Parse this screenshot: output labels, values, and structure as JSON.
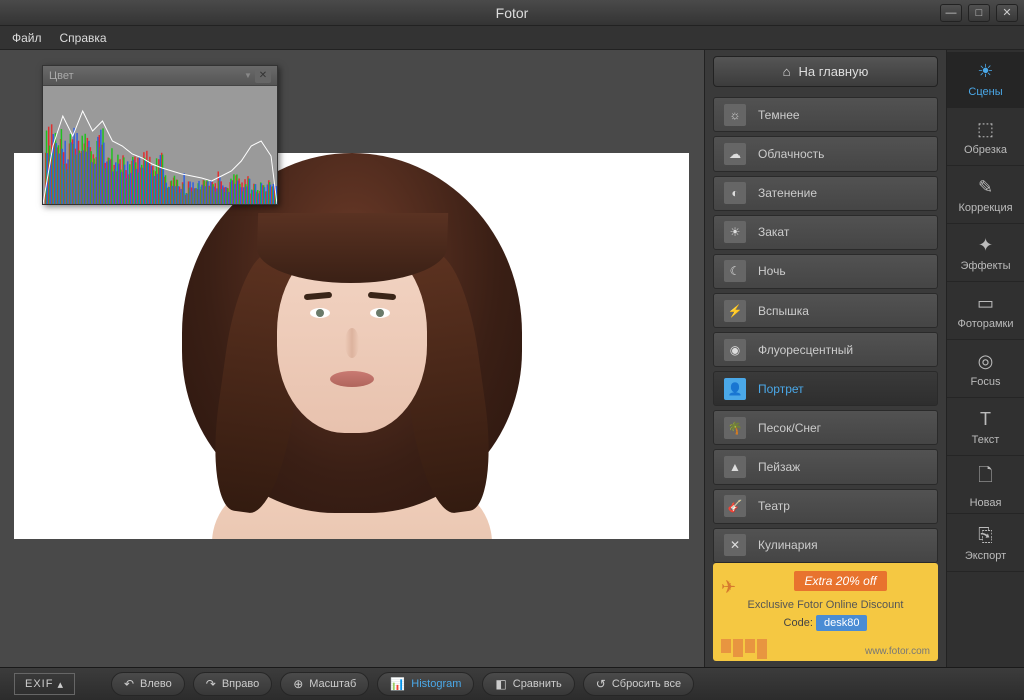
{
  "app": {
    "title": "Fotor"
  },
  "window": {
    "minimize": "—",
    "maximize": "□",
    "close": "✕"
  },
  "menu": {
    "file": "Файл",
    "help": "Справка"
  },
  "histogram": {
    "title": "Цвет"
  },
  "home_button": "На главную",
  "scenes": [
    {
      "icon": "☼",
      "label": "Темнее"
    },
    {
      "icon": "☁",
      "label": "Облачность"
    },
    {
      "icon": "◐",
      "label": "Затенение"
    },
    {
      "icon": "☀",
      "label": "Закат"
    },
    {
      "icon": "☾",
      "label": "Ночь"
    },
    {
      "icon": "⚡",
      "label": "Вспышка"
    },
    {
      "icon": "◉",
      "label": "Флуоресцентный"
    },
    {
      "icon": "👤",
      "label": "Портрет",
      "active": true
    },
    {
      "icon": "🌴",
      "label": "Песок/Снег"
    },
    {
      "icon": "▲",
      "label": "Пейзаж"
    },
    {
      "icon": "🎸",
      "label": "Театр"
    },
    {
      "icon": "✕",
      "label": "Кулинария"
    }
  ],
  "tools": [
    {
      "icon": "☀",
      "label": "Сцены",
      "active": true
    },
    {
      "icon": "⬚",
      "label": "Обрезка"
    },
    {
      "icon": "✎",
      "label": "Коррекция"
    },
    {
      "icon": "✦",
      "label": "Эффекты"
    },
    {
      "icon": "▭",
      "label": "Фоторамки"
    },
    {
      "icon": "◎",
      "label": "Focus"
    },
    {
      "icon": "T",
      "label": "Текст"
    },
    {
      "icon": "🗋",
      "label": "Новая"
    },
    {
      "icon": "⎘",
      "label": "Экспорт"
    }
  ],
  "promo": {
    "badge": "Extra 20% off",
    "text": "Exclusive Fotor Online Discount",
    "code_label": "Code:",
    "code": "desk80",
    "url": "www.fotor.com"
  },
  "bottom": {
    "exif": "EXIF",
    "buttons": [
      {
        "icon": "↶",
        "label": "Влево"
      },
      {
        "icon": "↷",
        "label": "Вправо"
      },
      {
        "icon": "⊕",
        "label": "Масштаб"
      },
      {
        "icon": "📊",
        "label": "Histogram",
        "active": true
      },
      {
        "icon": "◧",
        "label": "Сравнить"
      },
      {
        "icon": "↺",
        "label": "Сбросить все"
      }
    ]
  }
}
